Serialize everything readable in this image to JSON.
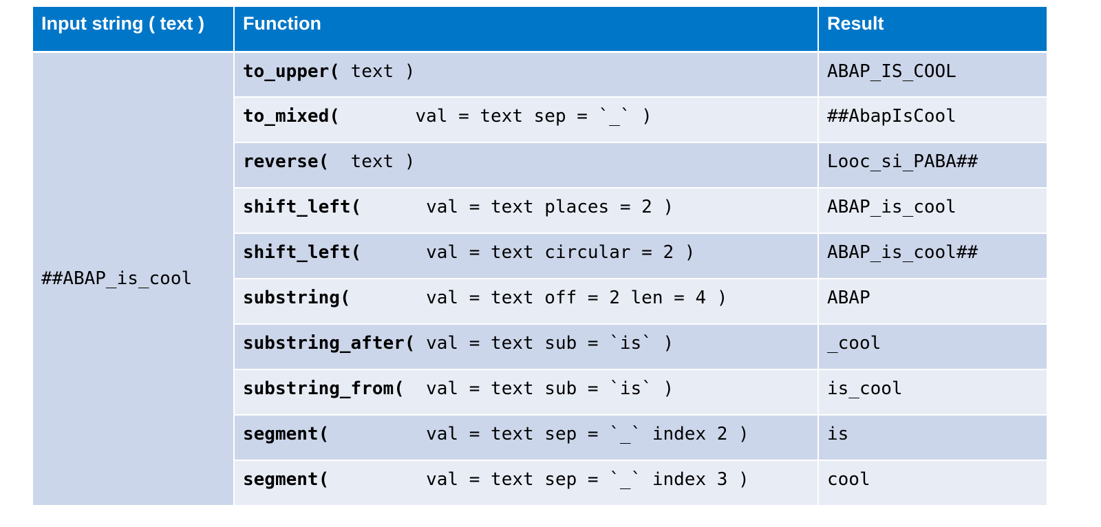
{
  "table": {
    "headers": {
      "input": "Input string ( text )",
      "function": "Function",
      "result": "Result"
    },
    "input_value": "##ABAP_is_cool",
    "rows": [
      {
        "fn_name": "to_upper(",
        "fn_args": " text )",
        "result": "ABAP_IS_COOL"
      },
      {
        "fn_name": "to_mixed(",
        "fn_args": "       val = text sep = `_` )",
        "result": "##AbapIsCool"
      },
      {
        "fn_name": "reverse(",
        "fn_args": "  text )",
        "result": "Looc_si_PABA##"
      },
      {
        "fn_name": "shift_left(",
        "fn_args": "      val = text places = 2 )",
        "result": "ABAP_is_cool"
      },
      {
        "fn_name": "shift_left(",
        "fn_args": "      val = text circular = 2 )",
        "result": "ABAP_is_cool##"
      },
      {
        "fn_name": "substring(",
        "fn_args": "       val = text off = 2 len = 4 )",
        "result": "ABAP"
      },
      {
        "fn_name": "substring_after(",
        "fn_args": " val = text sub = `is` )",
        "result": "_cool"
      },
      {
        "fn_name": "substring_from(",
        "fn_args": "  val = text sub = `is` )",
        "result": "is_cool"
      },
      {
        "fn_name": "segment(",
        "fn_args": "         val = text sep = `_` index 2 )",
        "result": "is"
      },
      {
        "fn_name": "segment(",
        "fn_args": "         val = text sep = `_` index 3 )",
        "result": "cool"
      }
    ]
  }
}
